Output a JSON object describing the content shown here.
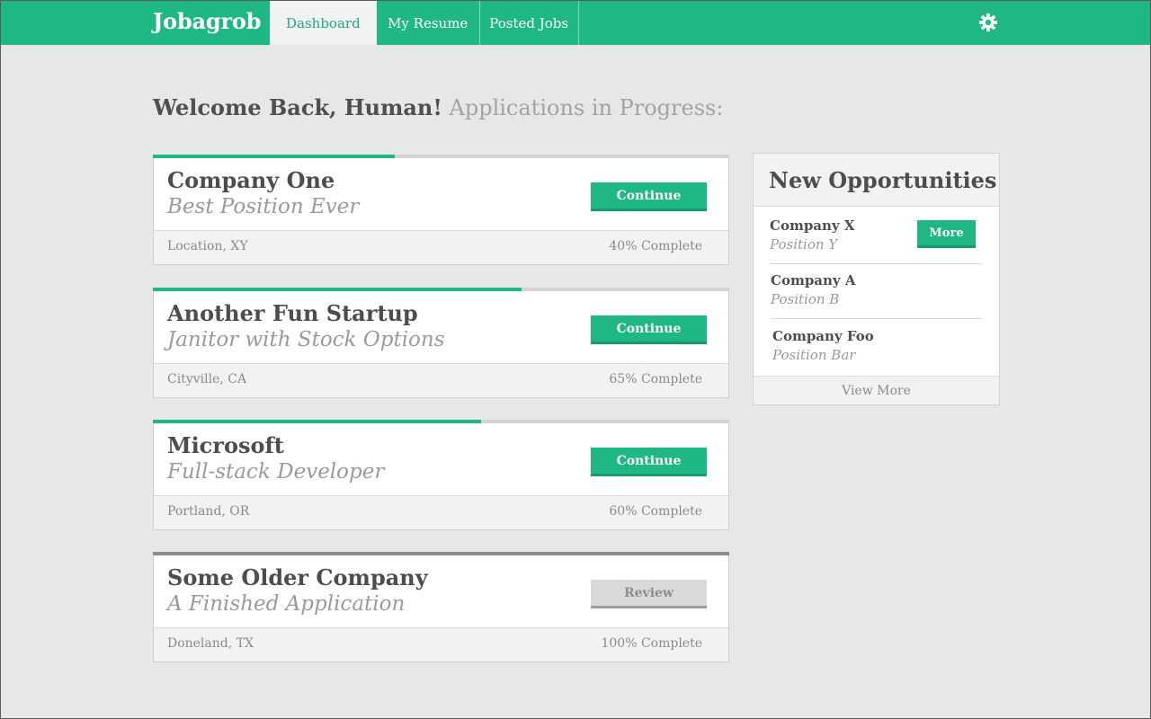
{
  "app": {
    "brand": "Jobagrob"
  },
  "nav": {
    "tabs": [
      {
        "label": "Dashboard",
        "active": true
      },
      {
        "label": "My Resume",
        "active": false
      },
      {
        "label": "Posted Jobs",
        "active": false
      }
    ],
    "settings_icon": "gear-icon"
  },
  "heading": {
    "greeting": "Welcome Back, Human!",
    "subtitle": "Applications in Progress:"
  },
  "applications": [
    {
      "company": "Company One",
      "position": "Best Position Ever",
      "location": "Location, XY",
      "progress_text": "40% Complete",
      "progress": 0.42,
      "action": "Continue"
    },
    {
      "company": "Another Fun Startup",
      "position": "Janitor with Stock Options",
      "location": "Cityville, CA",
      "progress_text": "65% Complete",
      "progress": 0.64,
      "action": "Continue"
    },
    {
      "company": "Microsoft",
      "position": "Full-stack Developer",
      "location": "Portland, OR",
      "progress_text": "60% Complete",
      "progress": 0.57,
      "action": "Continue"
    },
    {
      "company": "Some Older Company",
      "position": "A Finished Application",
      "location": "Doneland, TX",
      "progress_text": "100% Complete",
      "progress": 1.0,
      "action": "Review"
    }
  ],
  "opportunities": {
    "title": "New Opportunities",
    "items": [
      {
        "company": "Company X",
        "position": "Position Y"
      },
      {
        "company": "Company A",
        "position": "Position B"
      },
      {
        "company": "Company Foo",
        "position": "Position Bar"
      }
    ],
    "more_label": "More",
    "view_more_label": "View More"
  },
  "colors": {
    "accent": "#1fb784",
    "accent_dark": "#179a6d",
    "background": "#e6e7e9",
    "done_bar": "#8d8d8d"
  }
}
